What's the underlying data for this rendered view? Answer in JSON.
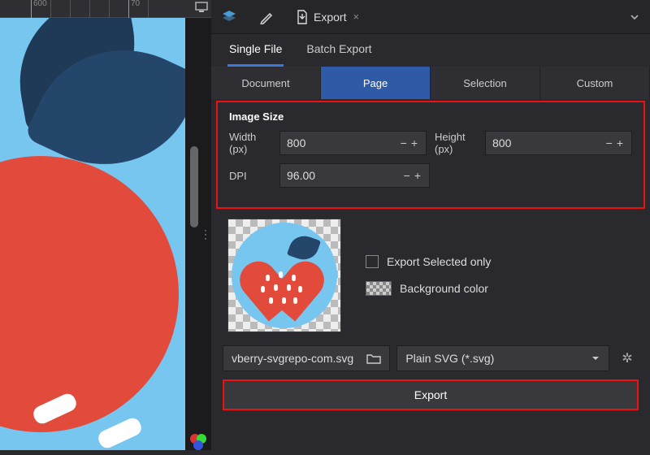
{
  "ruler": {
    "mark600": "600",
    "mark700": "70"
  },
  "panel_tab": {
    "title": "Export",
    "close": "×"
  },
  "mode_tabs": {
    "single": "Single File",
    "batch": "Batch Export"
  },
  "scope_tabs": {
    "document": "Document",
    "page": "Page",
    "selection": "Selection",
    "custom": "Custom"
  },
  "image_size": {
    "title": "Image Size",
    "width_label": "Width (px)",
    "width_value": "800",
    "height_label": "Height (px)",
    "height_value": "800",
    "dpi_label": "DPI",
    "dpi_value": "96.00"
  },
  "options": {
    "selected_only": "Export Selected only",
    "bg_color": "Background color"
  },
  "file": {
    "name": "vberry-svgrepo-com.svg"
  },
  "format": {
    "label": "Plain SVG (*.svg)"
  },
  "export_button": "Export"
}
